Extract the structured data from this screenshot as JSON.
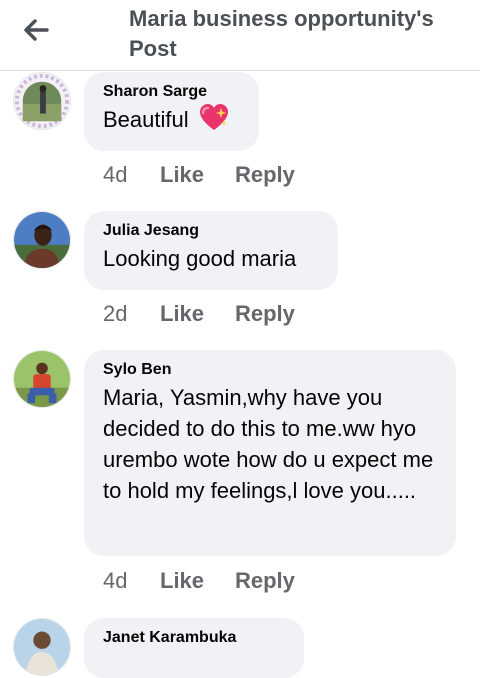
{
  "header": {
    "title": "Maria business opportunity's Post",
    "back_icon": "back-arrow-icon"
  },
  "comments": [
    {
      "author": "Sharon Sarge",
      "text": "Beautiful",
      "emoji_icon": "sparkling-heart-icon",
      "age": "4d",
      "like_label": "Like",
      "reply_label": "Reply"
    },
    {
      "author": "Julia Jesang",
      "text": "Looking good maria",
      "age": "2d",
      "like_label": "Like",
      "reply_label": "Reply"
    },
    {
      "author": "Sylo Ben",
      "text": "Maria, Yasmin,why have you decided to do this to me.ww hyo urembo wote how do u expect me to hold my feelings,l love you.....",
      "age": "4d",
      "like_label": "Like",
      "reply_label": "Reply"
    },
    {
      "author": "Janet Karambuka"
    }
  ],
  "colors": {
    "bubble": "#f0f2f5",
    "meta_text": "#65676b",
    "title_text": "#4b4f56"
  }
}
